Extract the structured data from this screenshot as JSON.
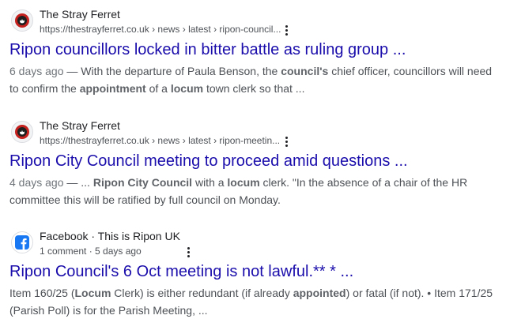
{
  "results": [
    {
      "site_name": "The Stray Ferret",
      "site_sub": "",
      "cite_host": "https://thestrayferret.co.uk",
      "cite_path": " › news › latest › ripon-council...",
      "favicon": "stray-ferret-icon",
      "title": "Ripon councillors locked in bitter battle as ruling group ...",
      "date": "6 days ago",
      "snippet_parts": [
        {
          "t": " — With the departure of Paula Benson, the ",
          "b": false
        },
        {
          "t": "council's",
          "b": true
        },
        {
          "t": " chief officer, councillors will need to confirm the ",
          "b": false
        },
        {
          "t": "appointment",
          "b": true
        },
        {
          "t": " of a ",
          "b": false
        },
        {
          "t": "locum",
          "b": true
        },
        {
          "t": " town clerk so that ...",
          "b": false
        }
      ]
    },
    {
      "site_name": "The Stray Ferret",
      "site_sub": "",
      "cite_host": "https://thestrayferret.co.uk",
      "cite_path": " › news › latest › ripon-meetin...",
      "favicon": "stray-ferret-icon",
      "title": "Ripon City Council meeting to proceed amid questions ...",
      "date": "4 days ago",
      "snippet_parts": [
        {
          "t": " — ... ",
          "b": false
        },
        {
          "t": "Ripon City Council",
          "b": true
        },
        {
          "t": " with a ",
          "b": false
        },
        {
          "t": "locum",
          "b": true
        },
        {
          "t": " clerk. \"In the absence of a chair of the HR committee this will be ratified by full council on Monday.",
          "b": false
        }
      ]
    },
    {
      "site_name": "Facebook",
      "site_sub": " · This is Ripon UK",
      "cite_host": "1 comment · 5 days ago",
      "cite_path": "",
      "favicon": "facebook-icon",
      "title": "Ripon Council's 6 Oct meeting is not lawful.** * ...",
      "date": "",
      "snippet_parts": [
        {
          "t": "Item 160/25 (",
          "b": false
        },
        {
          "t": "Locum",
          "b": true
        },
        {
          "t": " Clerk) is either redundant (if already ",
          "b": false
        },
        {
          "t": "appointed",
          "b": true
        },
        {
          "t": ") or fatal (if not). • Item 171/25 (Parish Poll) is for the Parish Meeting, ...",
          "b": false
        }
      ]
    }
  ],
  "colors": {
    "link": "#1a0dab",
    "snippet": "#4d5156",
    "ferret_red": "#c5221f",
    "facebook_blue": "#1877f2"
  }
}
